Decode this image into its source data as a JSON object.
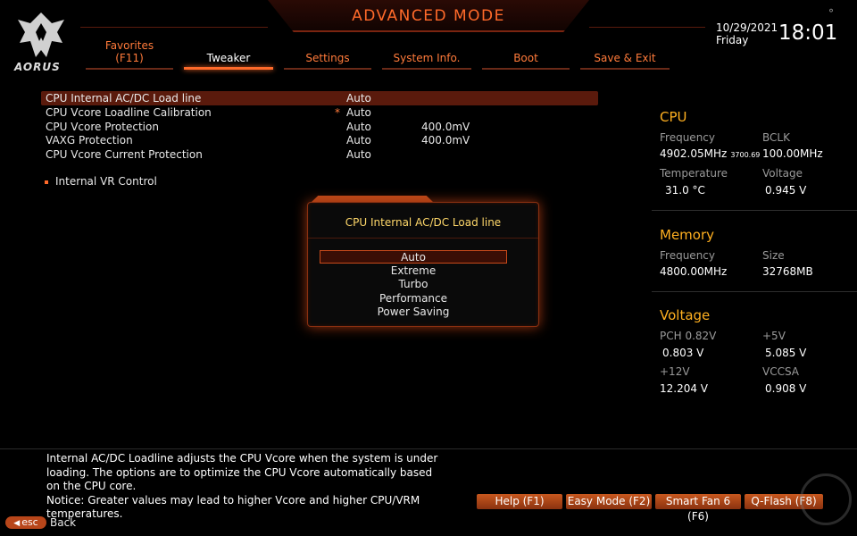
{
  "header": {
    "mode_title": "ADVANCED MODE",
    "logo_text": "AORUS",
    "date": "10/29/2021",
    "day": "Friday",
    "time": "18:01",
    "close_glyph": "°"
  },
  "tabs": [
    {
      "label": "Favorites",
      "sub": "(F11)",
      "active": false
    },
    {
      "label": "Tweaker",
      "active": true
    },
    {
      "label": "Settings",
      "active": false
    },
    {
      "label": "System Info.",
      "active": false
    },
    {
      "label": "Boot",
      "active": false
    },
    {
      "label": "Save & Exit",
      "active": false
    }
  ],
  "settings": [
    {
      "label": "CPU Internal AC/DC Load line",
      "value": "Auto",
      "value2": "",
      "star": "",
      "selected": true
    },
    {
      "label": "CPU Vcore Loadline Calibration",
      "value": "Auto",
      "value2": "",
      "star": "*",
      "selected": false
    },
    {
      "label": "CPU Vcore Protection",
      "value": "Auto",
      "value2": "400.0mV",
      "star": "",
      "selected": false
    },
    {
      "label": "VAXG Protection",
      "value": "Auto",
      "value2": "400.0mV",
      "star": "",
      "selected": false
    },
    {
      "label": "CPU Vcore Current Protection",
      "value": "Auto",
      "value2": "",
      "star": "",
      "selected": false
    }
  ],
  "submenu": {
    "label": "Internal VR Control"
  },
  "popup": {
    "title": "CPU Internal AC/DC Load line",
    "options": [
      "Auto",
      "Extreme",
      "Turbo",
      "Performance",
      "Power Saving"
    ],
    "selected": "Auto"
  },
  "info": {
    "cpu": {
      "title": "CPU",
      "freq_label": "Frequency",
      "freq_value": "4902.05MHz",
      "freq_small": "3700.69",
      "bclk_label": "BCLK",
      "bclk_value": "100.00MHz",
      "temp_label": "Temperature",
      "temp_value": "31.0 °C",
      "volt_label": "Voltage",
      "volt_value": "0.945 V"
    },
    "memory": {
      "title": "Memory",
      "freq_label": "Frequency",
      "freq_value": "4800.00MHz",
      "size_label": "Size",
      "size_value": "32768MB"
    },
    "voltage": {
      "title": "Voltage",
      "pch_label": "PCH 0.82V",
      "pch_value": "0.803 V",
      "v5_label": "+5V",
      "v5_value": "5.085 V",
      "v12_label": "+12V",
      "v12_value": "12.204 V",
      "vccsa_label": "VCCSA",
      "vccsa_value": "0.908 V"
    }
  },
  "help_text": "Internal AC/DC Loadline adjusts the CPU Vcore when the system is under loading. The options are to optimize the CPU Vcore automatically based on the CPU core.",
  "notice_text": "Notice: Greater values may lead to higher Vcore and higher CPU/VRM temperatures.",
  "footer": {
    "buttons": [
      "Help (F1)",
      "Easy Mode (F2)",
      "Smart Fan 6 (F6)",
      "Q-Flash (F8)"
    ],
    "esc_label": "esc",
    "back_label": "Back"
  },
  "colors": {
    "accent": "#ff6a2a",
    "panel_title": "#ffb020",
    "popup_title": "#ffd86a",
    "selection": "#5a1a0c"
  }
}
